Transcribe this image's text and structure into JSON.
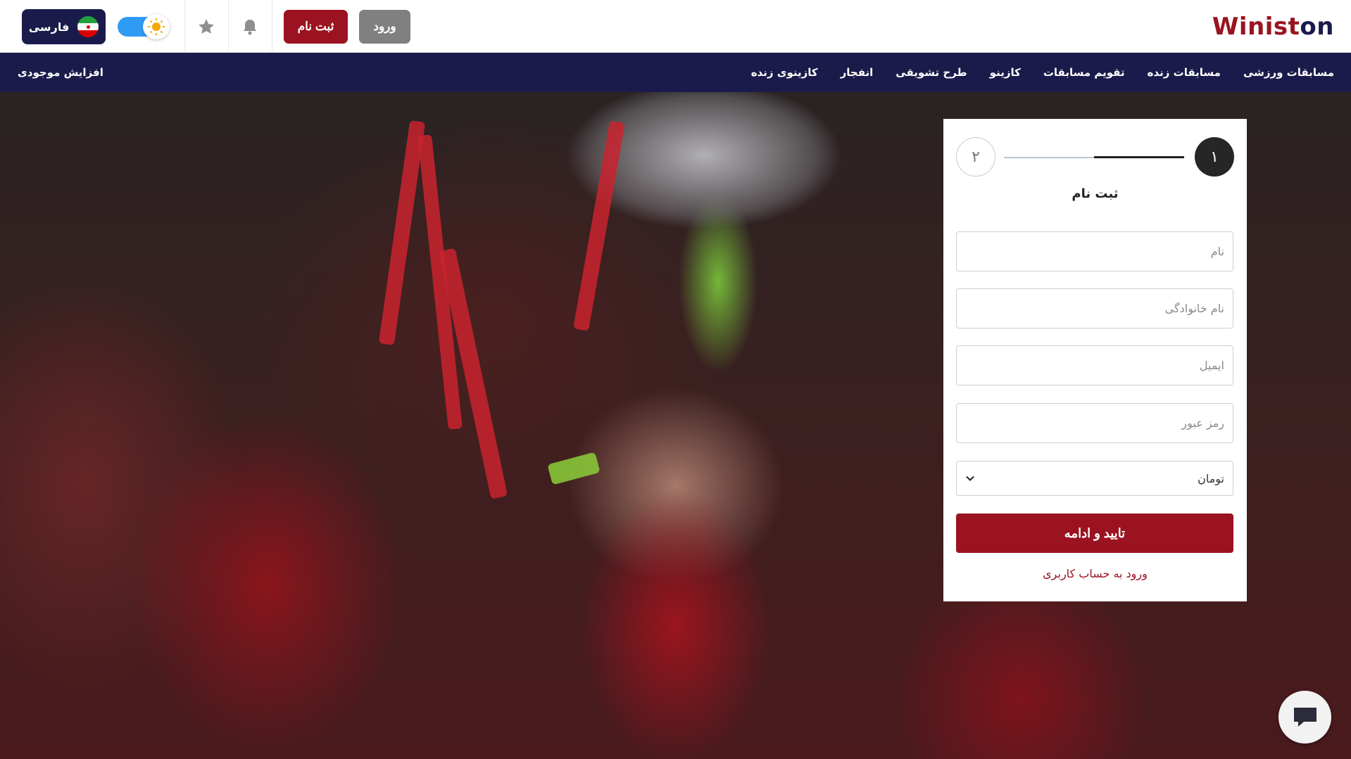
{
  "header": {
    "logo_text_a": "Winist",
    "logo_text_b": "on",
    "login_label": "ورود",
    "register_label": "ثبت نام",
    "language_label": "فارسی",
    "theme_toggle": "light"
  },
  "nav": {
    "items": [
      {
        "label": "مسابقات ورزشی"
      },
      {
        "label": "مسابقات زنده"
      },
      {
        "label": "تقویم مسابقات"
      },
      {
        "label": "کازینو"
      },
      {
        "label": "طرح تشویقی"
      },
      {
        "label": "انفجار"
      },
      {
        "label": "کازینوی زنده"
      }
    ],
    "deposit_label": "افزایش موجودی"
  },
  "form": {
    "step1": "۱",
    "step2": "۲",
    "title": "ثبت نام",
    "first_name_placeholder": "نام",
    "last_name_placeholder": "نام خانوادگی",
    "email_placeholder": "ایمیل",
    "password_placeholder": "رمز عبور",
    "currency_value": "تومان",
    "submit_label": "تایید و ادامه",
    "login_link": "ورود به حساب کاربری"
  },
  "colors": {
    "brand_red": "#9b1320",
    "navy": "#1b1b4b",
    "toggle_blue": "#2f9bf4"
  }
}
